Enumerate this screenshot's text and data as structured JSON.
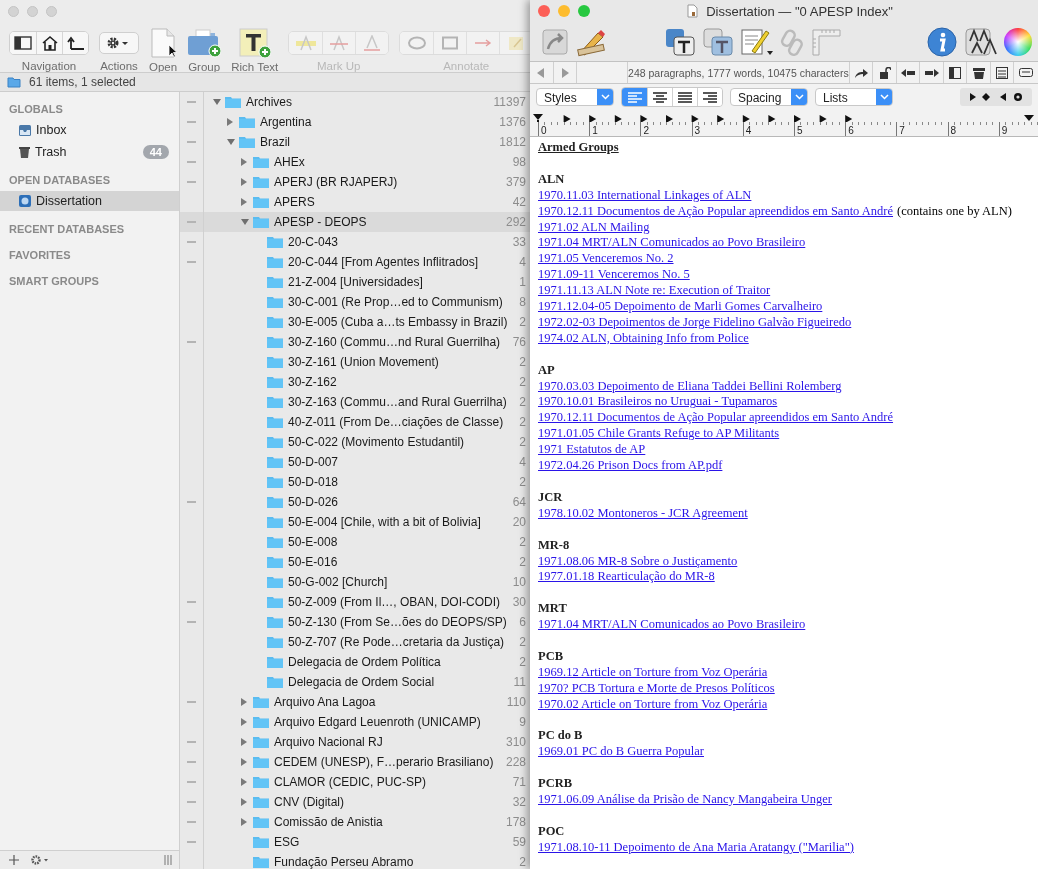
{
  "back_window": {
    "toolbar": [
      {
        "kind": "navigation",
        "label": "Navigation",
        "disabled": false
      },
      {
        "kind": "actions",
        "label": "Actions",
        "disabled": false
      },
      {
        "kind": "open",
        "label": "Open",
        "disabled": false
      },
      {
        "kind": "group",
        "label": "Group",
        "disabled": false
      },
      {
        "kind": "rich-text",
        "label": "Rich Text",
        "disabled": false
      },
      {
        "kind": "markup",
        "label": "Mark Up",
        "disabled": true
      },
      {
        "kind": "annotate",
        "label": "Annotate",
        "disabled": true
      }
    ],
    "status": "61 items, 1 selected",
    "sidebar": [
      {
        "heading": "GLOBALS",
        "items": [
          {
            "kind": "inbox",
            "label": "Inbox",
            "selected": false
          },
          {
            "kind": "trash",
            "label": "Trash",
            "badge": "44",
            "selected": false
          }
        ]
      },
      {
        "heading": "OPEN DATABASES",
        "items": [
          {
            "kind": "database",
            "label": "Dissertation",
            "selected": true
          }
        ]
      },
      {
        "heading": "RECENT DATABASES"
      },
      {
        "heading": "FAVORITES"
      },
      {
        "heading": "SMART GROUPS"
      }
    ],
    "tree": [
      {
        "name": "Archives",
        "count": "11397",
        "expandable": true,
        "expanded": true,
        "marked": true,
        "selected": false,
        "children": [
          {
            "name": "Argentina",
            "count": "1376",
            "expandable": true,
            "expanded": false,
            "marked": true,
            "selected": false
          },
          {
            "name": "Brazil",
            "count": "1812",
            "expandable": true,
            "expanded": true,
            "marked": true,
            "selected": false,
            "children": [
              {
                "name": "AHEx",
                "count": "98",
                "expandable": true,
                "expanded": false,
                "marked": true,
                "selected": false
              },
              {
                "name": "APERJ (BR RJAPERJ)",
                "count": "379",
                "expandable": true,
                "expanded": false,
                "marked": true,
                "selected": false
              },
              {
                "name": "APERS",
                "count": "42",
                "expandable": true,
                "expanded": false,
                "marked": false,
                "selected": false
              },
              {
                "name": "APESP - DEOPS",
                "count": "292",
                "expandable": true,
                "expanded": true,
                "marked": true,
                "selected": true,
                "children": [
                  {
                    "name": "20-C-043",
                    "count": "33",
                    "expandable": false,
                    "expanded": false,
                    "marked": true,
                    "selected": false
                  },
                  {
                    "name": "20-C-044 [From Agentes Inflitrados]",
                    "count": "4",
                    "expandable": false,
                    "expanded": false,
                    "marked": true,
                    "selected": false
                  },
                  {
                    "name": "21-Z-004 [Universidades]",
                    "count": "1",
                    "expandable": false,
                    "expanded": false,
                    "marked": false,
                    "selected": false
                  },
                  {
                    "name": "30-C-001 (Re Prop…ed to Communism)",
                    "count": "8",
                    "expandable": false,
                    "expanded": false,
                    "marked": false,
                    "selected": false
                  },
                  {
                    "name": "30-E-005 (Cuba a…ts Embassy in Brazil)",
                    "count": "2",
                    "expandable": false,
                    "expanded": false,
                    "marked": false,
                    "selected": false
                  },
                  {
                    "name": "30-Z-160 (Commu…nd Rural Guerrilha)",
                    "count": "76",
                    "expandable": false,
                    "expanded": false,
                    "marked": true,
                    "selected": false
                  },
                  {
                    "name": "30-Z-161 (Union Movement)",
                    "count": "2",
                    "expandable": false,
                    "expanded": false,
                    "marked": false,
                    "selected": false
                  },
                  {
                    "name": "30-Z-162",
                    "count": "2",
                    "expandable": false,
                    "expanded": false,
                    "marked": false,
                    "selected": false
                  },
                  {
                    "name": "30-Z-163 (Commu…and Rural Guerrilha)",
                    "count": "2",
                    "expandable": false,
                    "expanded": false,
                    "marked": false,
                    "selected": false
                  },
                  {
                    "name": "40-Z-011 (From De…ciações de Classe)",
                    "count": "2",
                    "expandable": false,
                    "expanded": false,
                    "marked": false,
                    "selected": false
                  },
                  {
                    "name": "50-C-022 (Movimento Estudantil)",
                    "count": "2",
                    "expandable": false,
                    "expanded": false,
                    "marked": false,
                    "selected": false
                  },
                  {
                    "name": "50-D-007",
                    "count": "4",
                    "expandable": false,
                    "expanded": false,
                    "marked": false,
                    "selected": false
                  },
                  {
                    "name": "50-D-018",
                    "count": "2",
                    "expandable": false,
                    "expanded": false,
                    "marked": false,
                    "selected": false
                  },
                  {
                    "name": "50-D-026",
                    "count": "64",
                    "expandable": false,
                    "expanded": false,
                    "marked": true,
                    "selected": false
                  },
                  {
                    "name": "50-E-004 [Chile, with a bit of Bolivia]",
                    "count": "20",
                    "expandable": false,
                    "expanded": false,
                    "marked": false,
                    "selected": false
                  },
                  {
                    "name": "50-E-008",
                    "count": "2",
                    "expandable": false,
                    "expanded": false,
                    "marked": false,
                    "selected": false
                  },
                  {
                    "name": "50-E-016",
                    "count": "2",
                    "expandable": false,
                    "expanded": false,
                    "marked": false,
                    "selected": false
                  },
                  {
                    "name": "50-G-002 [Church]",
                    "count": "10",
                    "expandable": false,
                    "expanded": false,
                    "marked": false,
                    "selected": false
                  },
                  {
                    "name": "50-Z-009 (From Il…, OBAN, DOI-CODI)",
                    "count": "30",
                    "expandable": false,
                    "expanded": false,
                    "marked": true,
                    "selected": false
                  },
                  {
                    "name": "50-Z-130 (From Se…ões do DEOPS/SP)",
                    "count": "6",
                    "expandable": false,
                    "expanded": false,
                    "marked": true,
                    "selected": false
                  },
                  {
                    "name": "50-Z-707 (Re Pode…cretaria da Justiça)",
                    "count": "2",
                    "expandable": false,
                    "expanded": false,
                    "marked": false,
                    "selected": false
                  },
                  {
                    "name": "Delegacia de Ordem Política",
                    "count": "2",
                    "expandable": false,
                    "expanded": false,
                    "marked": false,
                    "selected": false
                  },
                  {
                    "name": "Delegacia de Ordem Social",
                    "count": "11",
                    "expandable": false,
                    "expanded": false,
                    "marked": false,
                    "selected": false
                  }
                ]
              },
              {
                "name": "Arquivo Ana Lagoa",
                "count": "110",
                "expandable": true,
                "expanded": false,
                "marked": true,
                "selected": false
              },
              {
                "name": "Arquivo Edgard Leuenroth (UNICAMP)",
                "count": "9",
                "expandable": true,
                "expanded": false,
                "marked": false,
                "selected": false
              },
              {
                "name": "Arquivo Nacional RJ",
                "count": "310",
                "expandable": true,
                "expanded": false,
                "marked": true,
                "selected": false
              },
              {
                "name": "CEDEM (UNESP), F…perario Brasiliano)",
                "count": "228",
                "expandable": true,
                "expanded": false,
                "marked": true,
                "selected": false
              },
              {
                "name": "CLAMOR (CEDIC, PUC-SP)",
                "count": "71",
                "expandable": true,
                "expanded": false,
                "marked": true,
                "selected": false
              },
              {
                "name": "CNV (Digital)",
                "count": "32",
                "expandable": true,
                "expanded": false,
                "marked": true,
                "selected": false
              },
              {
                "name": "Comissão de Anistia",
                "count": "178",
                "expandable": true,
                "expanded": false,
                "marked": true,
                "selected": false
              },
              {
                "name": "ESG",
                "count": "59",
                "expandable": false,
                "expanded": false,
                "marked": true,
                "selected": false
              },
              {
                "name": "Fundação Perseu Abramo",
                "count": "2",
                "expandable": false,
                "expanded": false,
                "marked": false,
                "selected": false
              }
            ]
          }
        ]
      }
    ]
  },
  "editor": {
    "title": "Dissertation — \"0 APESP Index\"",
    "stats": "248 paragraphs, 1777 words, 10475 characters",
    "styles": "Styles",
    "alignments": [
      {
        "kind": "left",
        "selected": true
      },
      {
        "kind": "center",
        "selected": false
      },
      {
        "kind": "justify",
        "selected": false
      },
      {
        "kind": "right",
        "selected": false
      }
    ],
    "spacing": "Spacing",
    "lists": "Lists",
    "ruler": [
      "0",
      "1",
      "2",
      "3",
      "4",
      "5",
      "6",
      "7",
      "8",
      "9"
    ],
    "document": {
      "title": "Armed Groups",
      "sections": [
        {
          "heading": "ALN",
          "items": [
            {
              "link": "1970.11.03 International Linkages of ALN"
            },
            {
              "link": "1970.12.11 Documentos de Ação Popular apreendidos em Santo André",
              "note": "(contains one by ALN)"
            },
            {
              "link": "1971.02 ALN Mailing"
            },
            {
              "link": "1971.04 MRT/ALN Comunicados ao Povo Brasileiro"
            },
            {
              "link": "1971.05 Venceremos No. 2"
            },
            {
              "link": "1971.09-11 Venceremos No. 5"
            },
            {
              "link": "1971.11.13 ALN Note re: Execution of Traitor"
            },
            {
              "link": "1971.12.04-05 Depoimento de Marli Gomes Carvalheiro"
            },
            {
              "link": "1972.02-03 Depoimentos de Jorge Fidelino Galvão Figueiredo"
            },
            {
              "link": "1974.02 ALN, Obtaining Info from Police"
            }
          ]
        },
        {
          "heading": "AP",
          "items": [
            {
              "link": "1970.03.03 Depoimento de Eliana Taddei Bellini Rolemberg"
            },
            {
              "link": "1970.10.01 Brasileiros no Uruguai - Tupamaros"
            },
            {
              "link": "1970.12.11 Documentos de Ação Popular apreendidos em Santo André"
            },
            {
              "link": "1971.01.05 Chile Grants Refuge to AP Militants"
            },
            {
              "link": "1971 Estatutos de AP"
            },
            {
              "link": "1972.04.26 Prison Docs from AP.pdf"
            }
          ]
        },
        {
          "heading": "JCR",
          "items": [
            {
              "link": "1978.10.02 Montoneros - JCR Agreement"
            }
          ]
        },
        {
          "heading": "MR-8",
          "items": [
            {
              "link": "1971.08.06 MR-8 Sobre o Justiçamento"
            },
            {
              "link": "1977.01.18 Rearticulação do MR-8"
            }
          ]
        },
        {
          "heading": "MRT",
          "items": [
            {
              "link": "1971.04 MRT/ALN Comunicados ao Povo Brasileiro"
            }
          ]
        },
        {
          "heading": "PCB",
          "items": [
            {
              "link": "1969.12 Article on Torture from Voz Operária"
            },
            {
              "link": "1970? PCB Tortura e Morte de Presos Políticos"
            },
            {
              "link": "1970.02 Article on Torture from Voz Operária"
            }
          ]
        },
        {
          "heading": "PC do B",
          "items": [
            {
              "link": "1969.01 PC do B Guerra Popular"
            }
          ]
        },
        {
          "heading": "PCRB",
          "items": [
            {
              "link": "1971.06.09 Análise da Prisão de Nancy Mangabeira Unger"
            }
          ]
        },
        {
          "heading": "POC",
          "items": [
            {
              "link": "1971.08.10-11 Depoimento de Ana Maria Aratangy (\"Marilia\")"
            }
          ]
        }
      ]
    }
  }
}
